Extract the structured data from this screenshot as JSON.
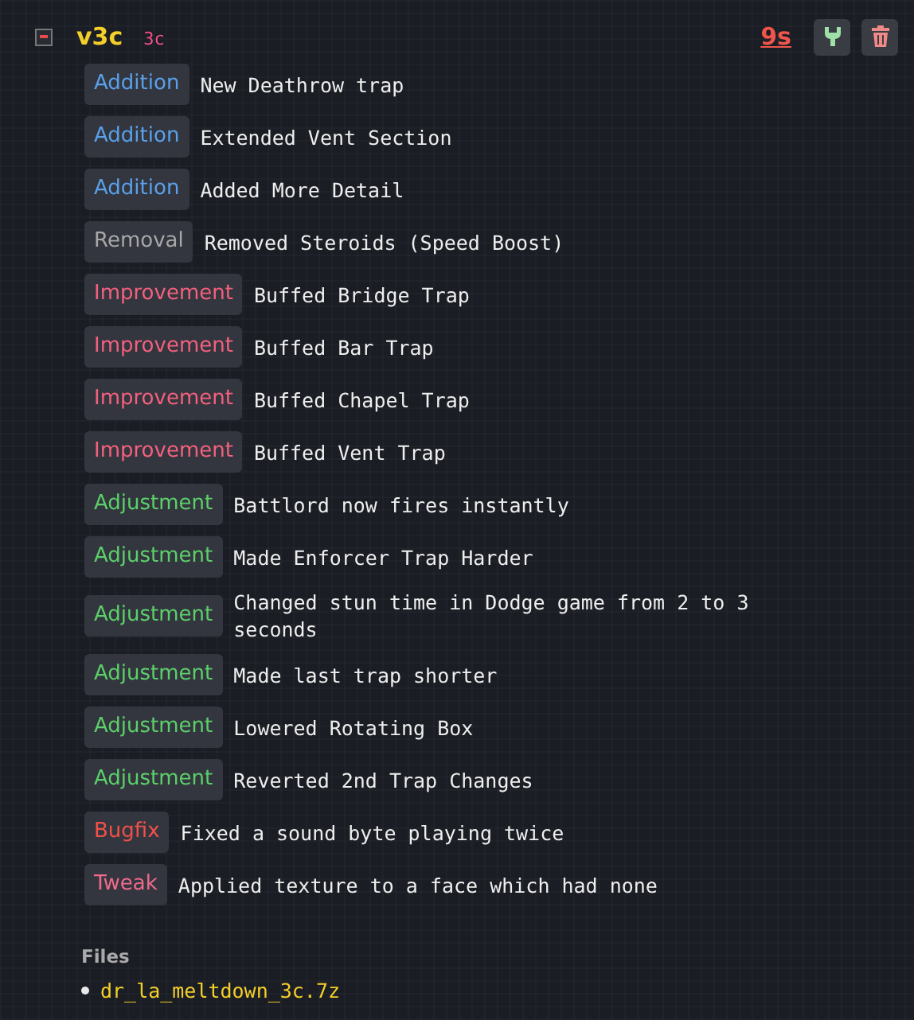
{
  "version": {
    "title": "v3c",
    "badge": "3c",
    "expanded": true,
    "age": "9s"
  },
  "entries": [
    {
      "kind": "addition",
      "tag": "Addition",
      "text": "New Deathrow trap"
    },
    {
      "kind": "addition",
      "tag": "Addition",
      "text": "Extended Vent Section"
    },
    {
      "kind": "addition",
      "tag": "Addition",
      "text": "Added More Detail"
    },
    {
      "kind": "removal",
      "tag": "Removal",
      "text": "Removed Steroids (Speed Boost)"
    },
    {
      "kind": "improvement",
      "tag": "Improvement",
      "text": "Buffed Bridge Trap"
    },
    {
      "kind": "improvement",
      "tag": "Improvement",
      "text": "Buffed Bar Trap"
    },
    {
      "kind": "improvement",
      "tag": "Improvement",
      "text": "Buffed Chapel Trap"
    },
    {
      "kind": "improvement",
      "tag": "Improvement",
      "text": "Buffed Vent Trap"
    },
    {
      "kind": "adjustment",
      "tag": "Adjustment",
      "text": "Battlord now fires instantly"
    },
    {
      "kind": "adjustment",
      "tag": "Adjustment",
      "text": "Made Enforcer Trap Harder"
    },
    {
      "kind": "adjustment",
      "tag": "Adjustment",
      "text": "Changed stun time in Dodge game from 2 to 3 seconds"
    },
    {
      "kind": "adjustment",
      "tag": "Adjustment",
      "text": "Made last trap shorter"
    },
    {
      "kind": "adjustment",
      "tag": "Adjustment",
      "text": "Lowered Rotating Box"
    },
    {
      "kind": "adjustment",
      "tag": "Adjustment",
      "text": "Reverted 2nd Trap Changes"
    },
    {
      "kind": "bugfix",
      "tag": "Bugfix",
      "text": "Fixed a sound byte playing twice"
    },
    {
      "kind": "tweak",
      "tag": "Tweak",
      "text": "Applied texture to a face which had none"
    }
  ],
  "files": {
    "heading": "Files",
    "items": [
      "dr_la_meltdown_3c.7z"
    ]
  }
}
